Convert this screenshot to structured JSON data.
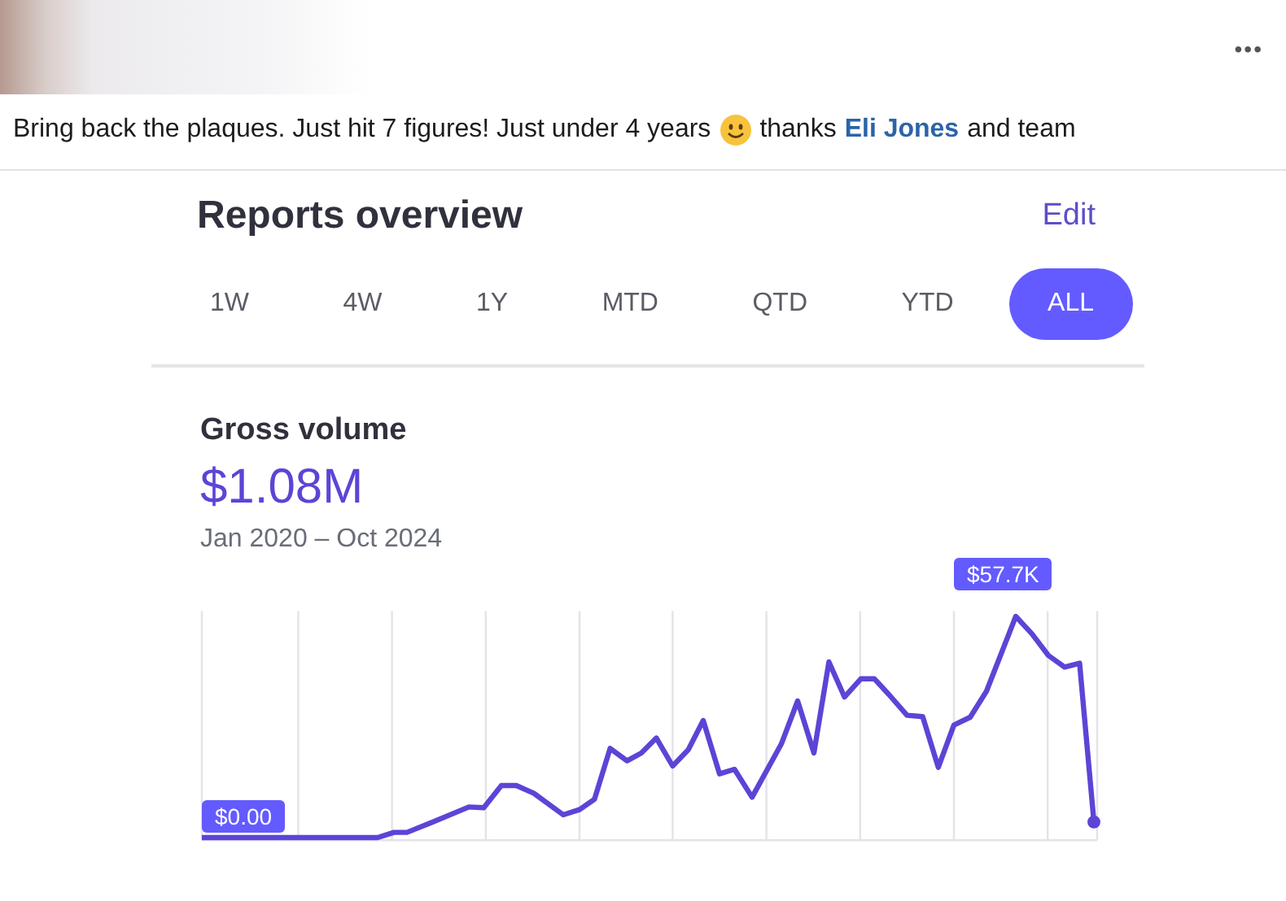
{
  "post": {
    "menu": "•••",
    "text_before": "Bring back the plaques. Just hit 7 figures! Just under 4 years",
    "text_after_emoji": "thanks",
    "mention": "Eli Jones",
    "text_end": "and team"
  },
  "report": {
    "title": "Reports overview",
    "edit": "Edit",
    "tabs": [
      {
        "label": "1W",
        "selected": false
      },
      {
        "label": "4W",
        "selected": false
      },
      {
        "label": "1Y",
        "selected": false
      },
      {
        "label": "MTD",
        "selected": false
      },
      {
        "label": "QTD",
        "selected": false
      },
      {
        "label": "YTD",
        "selected": false
      },
      {
        "label": "ALL",
        "selected": true
      }
    ],
    "metric": {
      "label": "Gross volume",
      "value": "$1.08M",
      "range": "Jan 2020 – Oct 2024"
    },
    "chart": {
      "max_label": "$57.7K",
      "min_label": "$0.00"
    }
  }
}
